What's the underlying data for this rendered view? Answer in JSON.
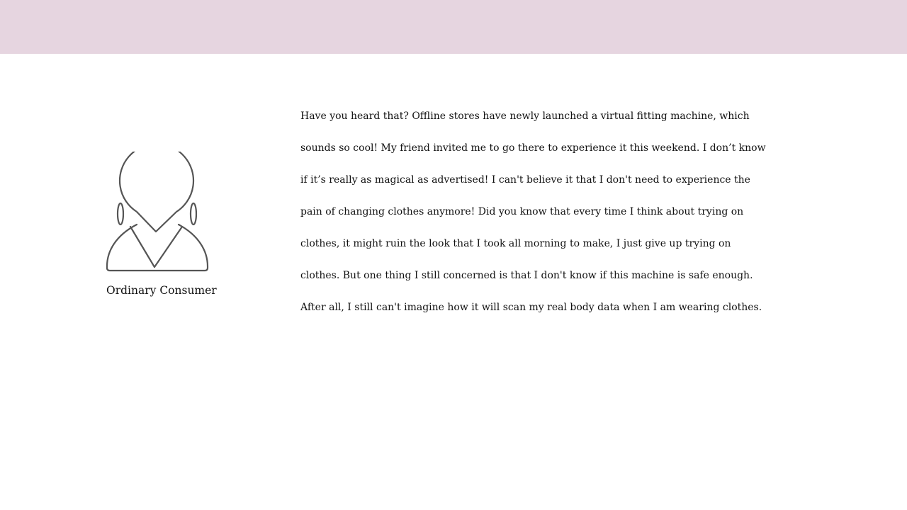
{
  "colors": {
    "header_bar": "#e6d5e0",
    "icon_stroke": "#555555",
    "text": "#111111",
    "background": "#ffffff"
  },
  "persona": {
    "icon": "woman-user-icon",
    "label": "Ordinary Consumer"
  },
  "quote": {
    "lines": [
      "Have you heard that? Offline stores have newly launched a virtual fitting machine, which",
      "sounds so cool! My friend invited me to go there to experience it this weekend. I don’t know",
      "if it’s really as magical as advertised! I can't believe it that I don't need to experience the",
      "pain of changing clothes anymore! Did you know that every time I think about trying on",
      "clothes, it might ruin the look that I took all morning to make, I just give up trying on",
      "clothes. But one thing I still concerned is that I don't know if this machine is safe enough.",
      "After all, I still can't imagine how it will scan my real body data when I am wearing clothes."
    ]
  }
}
